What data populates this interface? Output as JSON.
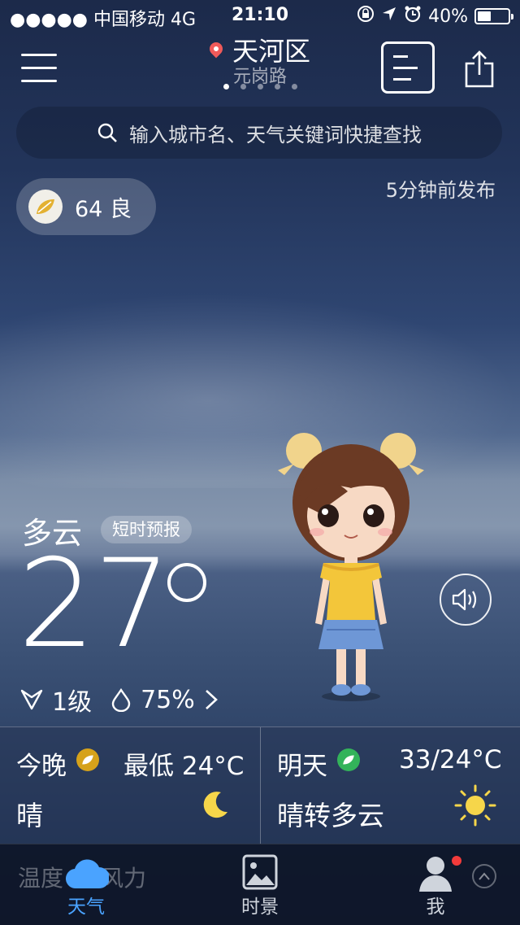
{
  "status": {
    "carrier": "●●●●● 中国移动  4G",
    "time": "21:10",
    "battery": "40%"
  },
  "header": {
    "city": "天河区",
    "street": "元岗路",
    "search_placeholder": "输入城市名、天气关键词快捷查找",
    "page_dots": 5,
    "active_dot": 0
  },
  "aqi": {
    "label": "64 良",
    "published": "5分钟前发布"
  },
  "current": {
    "condition": "多云",
    "nowcast_label": "短时预报",
    "temperature": "27",
    "wind": "1级",
    "humidity": "75%"
  },
  "forecast": {
    "tonight": {
      "title": "今晚",
      "low_label": "最低 24°C",
      "condition": "晴",
      "aqi_color": "#d6a21a"
    },
    "tomorrow": {
      "title": "明天",
      "range_label": "33/24°C",
      "condition": "晴转多云",
      "aqi_color": "#33b35a"
    }
  },
  "tabs": [
    {
      "label": "天气",
      "active": true,
      "color": "#4aa3ff"
    },
    {
      "label": "时景",
      "active": false
    },
    {
      "label": "我",
      "active": false
    }
  ],
  "ghost_text": {
    "left": "温度",
    "right": "风力"
  }
}
